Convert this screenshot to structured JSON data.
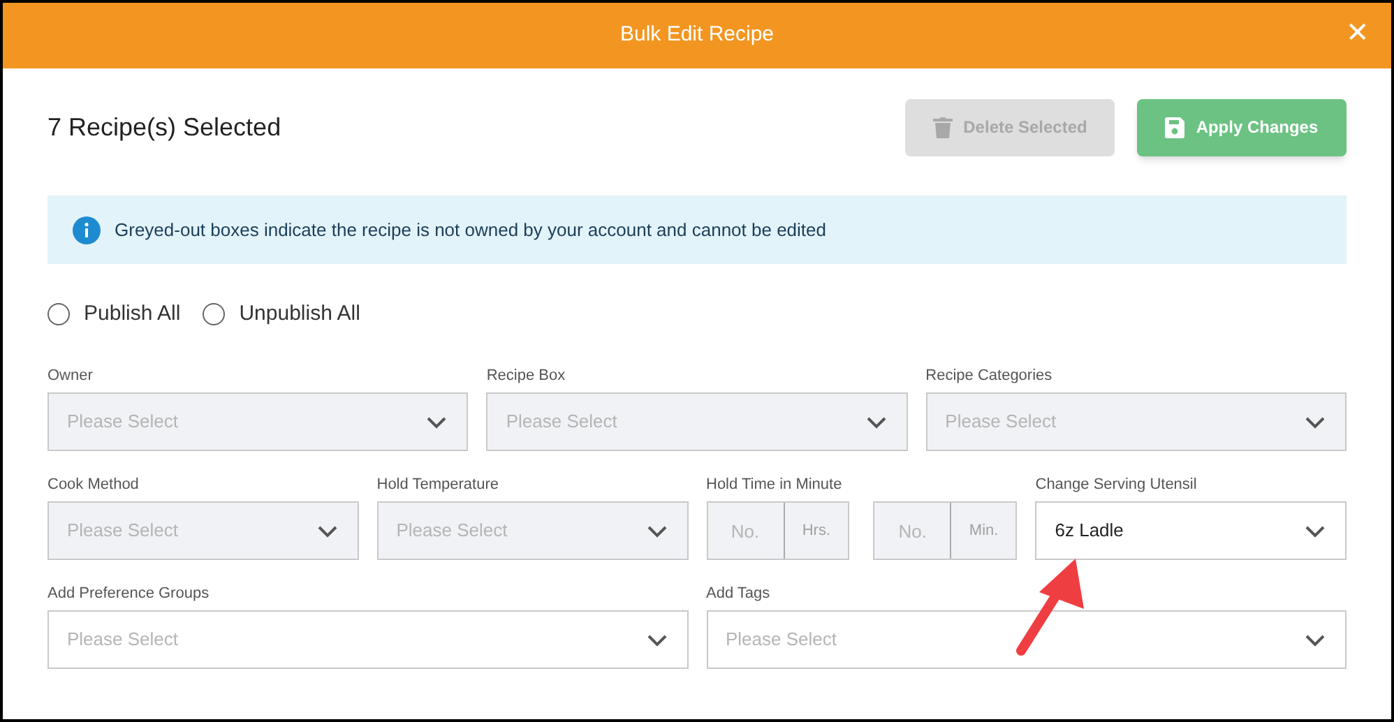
{
  "window": {
    "title": "Bulk Edit Recipe",
    "close": "✕"
  },
  "heading": "7 Recipe(s) Selected",
  "buttons": [
    {
      "kind": "delete",
      "label": "Delete Selected",
      "disabled": true
    },
    {
      "kind": "apply",
      "label": "Apply Changes",
      "disabled": false
    }
  ],
  "notice": "Greyed-out boxes indicate the recipe is not owned by your account and cannot be edited",
  "publish_options": [
    {
      "label": "Publish All",
      "selected": false
    },
    {
      "label": "Unpublish All",
      "selected": false
    }
  ],
  "field_rows": [
    {
      "fields": [
        {
          "kind": "select",
          "label": "Owner",
          "placeholder": "Please Select",
          "disabled": true
        },
        {
          "kind": "select",
          "label": "Recipe Box",
          "placeholder": "Please Select",
          "disabled": true
        },
        {
          "kind": "select",
          "label": "Recipe Categories",
          "placeholder": "Please Select",
          "disabled": true
        }
      ]
    },
    {
      "fields": [
        {
          "kind": "select",
          "label": "Cook Method",
          "placeholder": "Please Select",
          "disabled": true
        },
        {
          "kind": "select",
          "label": "Hold Temperature",
          "placeholder": "Please Select",
          "disabled": true
        },
        {
          "kind": "time",
          "label": "Hold Time in Minute",
          "disabled": true,
          "parts": [
            {
              "placeholder": "No.",
              "unit": "Hrs."
            },
            {
              "placeholder": "No.",
              "unit": "Min."
            }
          ]
        },
        {
          "kind": "select",
          "label": "Change Serving Utensil",
          "value": "6z Ladle",
          "disabled": false
        }
      ]
    },
    {
      "fields": [
        {
          "kind": "select",
          "label": "Add Preference Groups",
          "placeholder": "Please Select",
          "disabled": false
        },
        {
          "kind": "select",
          "label": "Add Tags",
          "placeholder": "Please Select",
          "disabled": false
        }
      ]
    }
  ]
}
